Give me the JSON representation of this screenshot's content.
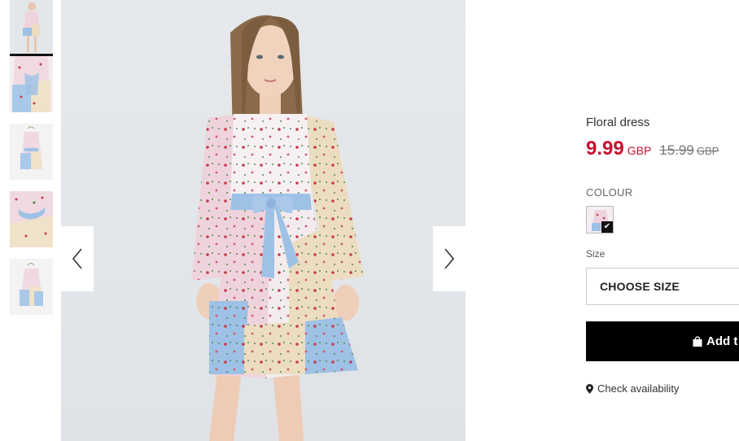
{
  "product": {
    "title": "Floral dress",
    "price": "9.99",
    "currency": "GBP",
    "old_price": "15.99",
    "old_currency": "GBP"
  },
  "colour": {
    "label": "COLOUR",
    "selected": "floral-patchwork"
  },
  "size": {
    "label": "Size",
    "placeholder": "CHOOSE SIZE"
  },
  "cart": {
    "button_label": "Add t"
  },
  "availability": {
    "label": "Check availability"
  },
  "gallery": {
    "thumbnail_count": 5,
    "active_index": 0
  },
  "icons": {
    "prev": "chevron-left-icon",
    "next": "chevron-right-icon",
    "bag": "shopping-bag-icon",
    "location": "location-pin-icon",
    "check": "check-icon"
  },
  "colors": {
    "price_red": "#c8102e",
    "button_black": "#000000",
    "dress_pink": "#efd3dc",
    "dress_blue": "#9ec1e6",
    "dress_cream": "#ecdcc0"
  }
}
